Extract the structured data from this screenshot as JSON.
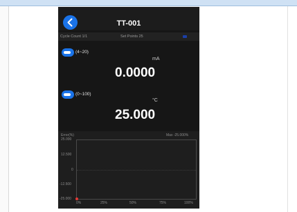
{
  "header": {
    "title": "TT-001"
  },
  "status": {
    "cycle_count": "Cycle Count 1/1",
    "set_points": "Set Points 25"
  },
  "input": {
    "range": "(4~20)",
    "unit": "mA",
    "value": "0.0000"
  },
  "output": {
    "range": "(0~100)",
    "unit": "°C",
    "value": "25.000"
  },
  "graph": {
    "ylabel": "Error(%)",
    "max_label": "Max -25.000%",
    "y_ticks": [
      "25.000",
      "12.500",
      "0",
      "-12.500",
      "-25.000"
    ],
    "x_ticks": [
      "0%",
      "25%",
      "50%",
      "75%",
      "100%"
    ]
  },
  "colors": {
    "accent": "#1a73e8",
    "screen_bg": "#161616",
    "data_marker": "#e53935"
  }
}
